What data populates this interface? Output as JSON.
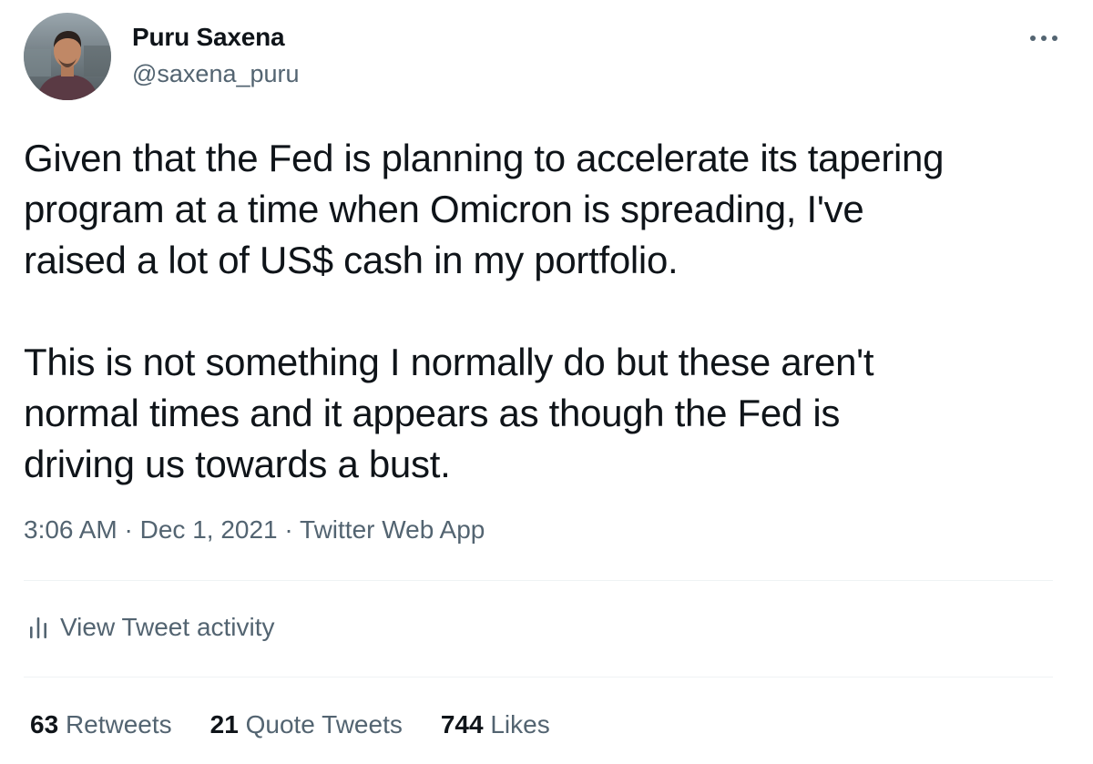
{
  "author": {
    "display_name": "Puru Saxena",
    "handle": "@saxena_puru"
  },
  "tweet": {
    "lines_p1": [
      "Given that the Fed is planning to accelerate its tapering",
      "program at a time when Omicron is spreading, I've",
      "raised a lot of US$ cash in my portfolio."
    ],
    "lines_p2": [
      "This is not something I normally do but these aren't",
      "normal times and it appears as though the Fed is",
      "driving us towards a bust."
    ],
    "time": "3:06 AM",
    "separator": " · ",
    "date": "Dec 1, 2021",
    "source": "Twitter Web App"
  },
  "activity": {
    "label": "View Tweet activity",
    "icon": "bar-chart-icon"
  },
  "stats": {
    "retweets_count": "63",
    "retweets_label": "Retweets",
    "quotes_count": "21",
    "quotes_label": "Quote Tweets",
    "likes_count": "744",
    "likes_label": "Likes"
  },
  "icons": {
    "more": "more-horizontal-icon",
    "avatar": "profile-photo"
  },
  "colors": {
    "text_primary": "#0f1419",
    "text_secondary": "#536471",
    "divider": "#eff3f4"
  }
}
